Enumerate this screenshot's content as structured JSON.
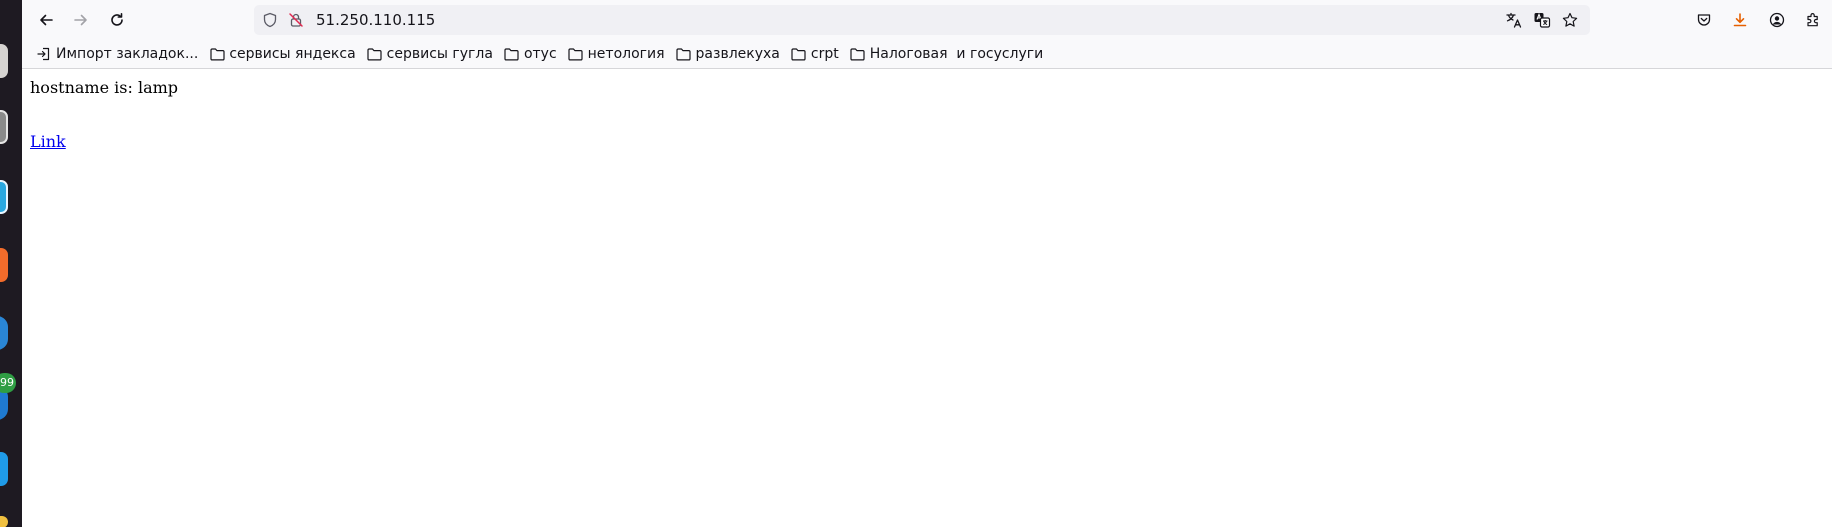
{
  "browser": {
    "address": "51.250.110.115",
    "toolbar_icons": [
      "back-arrow-icon",
      "forward-arrow-icon",
      "reload-icon",
      "shield-icon",
      "insecure-lock-icon",
      "translate-icon",
      "page-translate-icon",
      "bookmark-star-icon",
      "pocket-icon",
      "download-icon",
      "account-icon",
      "extensions-icon"
    ],
    "accent_download": "#e66000"
  },
  "bookmarks": [
    {
      "label": "Импорт закладок...",
      "icon": "import-icon"
    },
    {
      "label": "сервисы яндекса",
      "icon": "folder-icon"
    },
    {
      "label": "сервисы гугла",
      "icon": "folder-icon"
    },
    {
      "label": "отус",
      "icon": "folder-icon"
    },
    {
      "label": "нетология",
      "icon": "folder-icon"
    },
    {
      "label": "развлекуха",
      "icon": "folder-icon"
    },
    {
      "label": "crpt",
      "icon": "folder-icon"
    },
    {
      "label": "Налоговая  и госуслуги",
      "icon": "folder-icon"
    }
  ],
  "page": {
    "hostname_text": "hostname is: lamp",
    "link_label": "Link",
    "link_color": "#0000ee"
  },
  "dock": {
    "badge": "99"
  }
}
